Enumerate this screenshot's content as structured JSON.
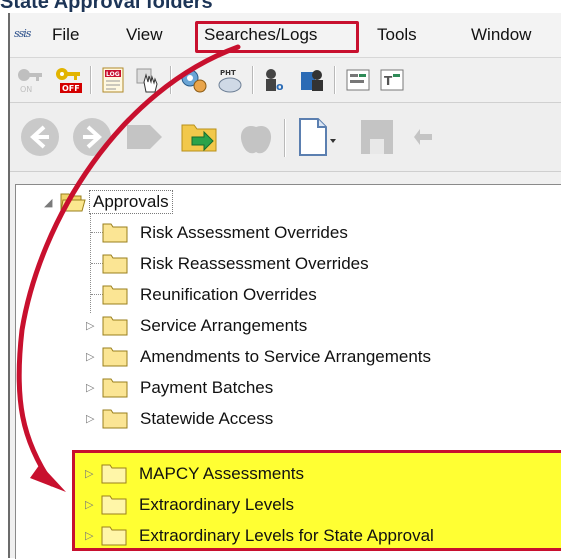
{
  "page": {
    "title": "State Approval folders"
  },
  "menubar": {
    "app_icon": "ssis",
    "items": [
      {
        "label": "File"
      },
      {
        "label": "View"
      },
      {
        "label": "Searches/Logs"
      },
      {
        "label": "Tools"
      },
      {
        "label": "Window"
      }
    ],
    "highlighted_item": "Searches/Logs",
    "highlight_color": "#c8102e"
  },
  "toolbar1": {
    "buttons": [
      {
        "icon": "key-on-icon",
        "text": "ON"
      },
      {
        "icon": "key-off-icon",
        "text": "OFF"
      },
      {
        "icon": "log-icon",
        "text": "LOG"
      },
      {
        "icon": "hand-pointer-icon"
      },
      {
        "icon": "gear-people-icon"
      },
      {
        "icon": "pht-icon",
        "text": "PHT"
      },
      {
        "icon": "people-30-icon"
      },
      {
        "icon": "people-card-icon"
      },
      {
        "icon": "form-icon"
      },
      {
        "icon": "form-text-icon"
      }
    ]
  },
  "toolbar2": {
    "buttons": [
      {
        "icon": "back-arrow-icon"
      },
      {
        "icon": "forward-arrow-icon"
      },
      {
        "icon": "tag-icon"
      },
      {
        "icon": "folder-open-arrow-icon"
      },
      {
        "icon": "apple-icon"
      },
      {
        "icon": "new-document-icon"
      },
      {
        "icon": "save-disk-icon"
      },
      {
        "icon": "undo-icon"
      }
    ]
  },
  "tree": {
    "root": {
      "label": "Approvals",
      "expanded": true
    },
    "children": [
      {
        "label": "Risk Assessment Overrides",
        "has_children": false
      },
      {
        "label": "Risk Reassessment Overrides",
        "has_children": false
      },
      {
        "label": "Reunification Overrides",
        "has_children": false
      },
      {
        "label": "Service Arrangements",
        "has_children": true
      },
      {
        "label": "Amendments to Service Arrangements",
        "has_children": true
      },
      {
        "label": "Payment Batches",
        "has_children": true
      },
      {
        "label": "Statewide Access",
        "has_children": true
      },
      {
        "label": "MAPCY Assessments",
        "has_children": true,
        "highlighted": true
      },
      {
        "label": "Extraordinary Levels",
        "has_children": true,
        "highlighted": true
      },
      {
        "label": "Extraordinary Levels for State Approval",
        "has_children": true,
        "highlighted": true
      }
    ],
    "highlight_fill": "#ffff33",
    "highlight_border": "#c8102e"
  }
}
